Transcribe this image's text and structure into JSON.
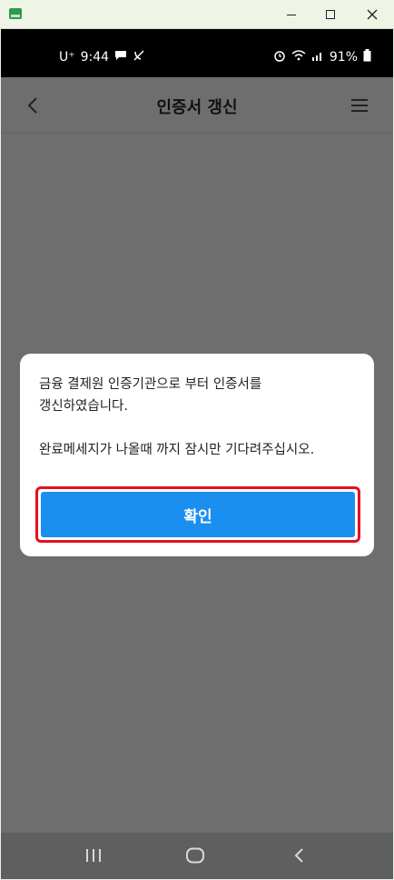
{
  "window": {
    "app_icon": "spreadsheet-app-icon",
    "controls": {
      "minimize": "minimize-icon",
      "maximize": "maximize-icon",
      "close": "close-icon"
    }
  },
  "status_bar": {
    "carrier": "U⁺",
    "time": "9:44",
    "battery": "91%",
    "icons": [
      "message-icon",
      "no-call-icon",
      "alarm-icon",
      "wifi-icon",
      "signal-icon",
      "battery-icon"
    ]
  },
  "app_bar": {
    "title": "인증서 갱신",
    "back_icon": "chevron-left-icon",
    "menu_icon": "hamburger-menu-icon"
  },
  "dialog": {
    "line1": "금융 결제원 인증기관으로 부터 인증서를",
    "line2": "갱신하였습니다.",
    "line3": "완료메세지가 나올때 까지 잠시만 기다려주십시오.",
    "confirm_label": "확인",
    "accent_color": "#1b8fef",
    "highlight_color": "#e6101f"
  },
  "nav_bar": {
    "items": [
      "recents-icon",
      "home-icon",
      "back-icon"
    ]
  }
}
